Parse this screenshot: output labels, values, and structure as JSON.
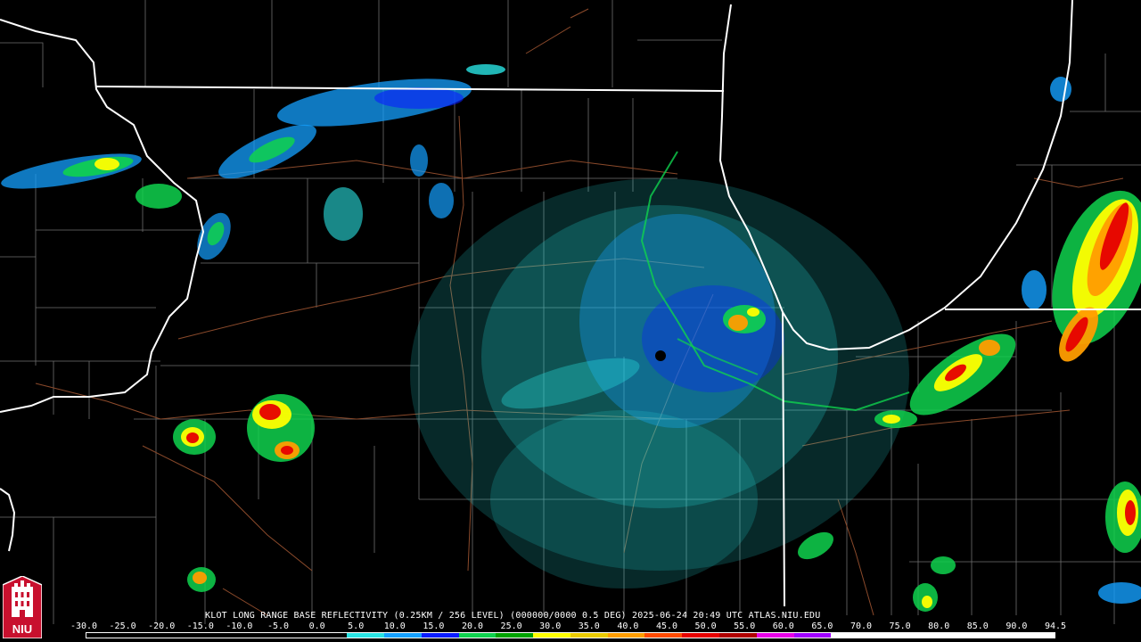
{
  "caption": "KLOT LONG RANGE BASE REFLECTIVITY (0.25KM / 256 LEVEL) (000000/0000 0.5 DEG) 2025-06-24 20:49 UTC  ATLAS.NIU.EDU",
  "scale": {
    "labels": [
      "-30.0",
      "-25.0",
      "-20.0",
      "-15.0",
      "-10.0",
      "-5.0",
      "0.0",
      "5.0",
      "10.0",
      "15.0",
      "20.0",
      "25.0",
      "30.0",
      "35.0",
      "40.0",
      "45.0",
      "50.0",
      "55.0",
      "60.0",
      "65.0",
      "70.0",
      "75.0",
      "80.0",
      "85.0",
      "90.0",
      "94.5"
    ],
    "colors": [
      "#000000",
      "#000000",
      "#000000",
      "#000000",
      "#000000",
      "#000000",
      "#000000",
      "#29e3e3",
      "#14a0ff",
      "#0a1dff",
      "#0fd24e",
      "#00a300",
      "#ffff00",
      "#eaca00",
      "#ff9d00",
      "#ff4a00",
      "#e60000",
      "#b00000",
      "#e600e6",
      "#a000ff",
      "#ffffff",
      "#ffffff",
      "#ffffff",
      "#ffffff",
      "#ffffff",
      "#ffffff"
    ]
  },
  "logo": {
    "text": "NIU",
    "colors": {
      "red": "#c8102e",
      "white": "#ffffff",
      "black": "#000000"
    }
  },
  "map": {
    "radar_site": "KLOT",
    "colors": {
      "state_border": "#ffffff",
      "county_line": "#7a7a7a",
      "road": "#8b4a2b",
      "light_echo": "#29e3e3",
      "mid_echo": "#14a0ff",
      "blue_echo": "#0a1dff",
      "green_echo": "#0fd24e",
      "yellow_echo": "#ffff00",
      "orange_echo": "#ff9d00",
      "red_echo": "#e60000"
    }
  }
}
